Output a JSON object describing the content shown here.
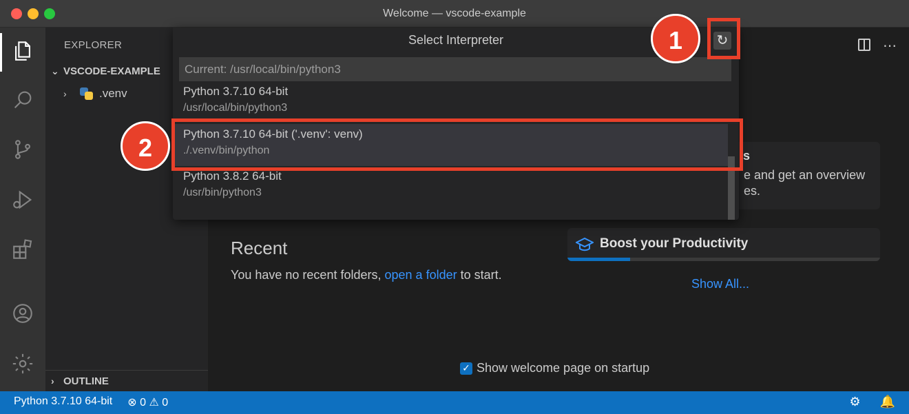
{
  "window": {
    "title": "Welcome — vscode-example"
  },
  "sidebar": {
    "title": "EXPLORER",
    "section_label": "VSCODE-EXAMPLE",
    "items": [
      {
        "label": ".venv"
      }
    ],
    "outline_label": "OUTLINE"
  },
  "quickpick": {
    "title": "Select Interpreter",
    "input_value": "Current: /usr/local/bin/python3",
    "items": [
      {
        "label": "Python 3.7.10 64-bit",
        "description": "/usr/local/bin/python3"
      },
      {
        "label": "Python 3.7.10 64-bit ('.venv': venv)",
        "description": "./.venv/bin/python"
      },
      {
        "label": "Python 3.8.2 64-bit",
        "description": "/usr/bin/python3"
      }
    ]
  },
  "welcome": {
    "walkthrough_title_fragment": "ls",
    "walkthrough_desc_line1": "e and get an overview",
    "walkthrough_desc_line2": "es.",
    "recent_heading": "Recent",
    "recent_text_before": "You have no recent folders,",
    "recent_link": "open a folder",
    "recent_text_after": "to start.",
    "boost_title": "Boost your Productivity",
    "boost_progress": 0.2,
    "show_all": "Show All...",
    "startup_label": "Show welcome page on startup"
  },
  "annotations": {
    "badge1": "1",
    "badge2": "2"
  },
  "statusbar": {
    "interpreter": "Python 3.7.10 64-bit",
    "errors": "0",
    "warnings": "0"
  }
}
